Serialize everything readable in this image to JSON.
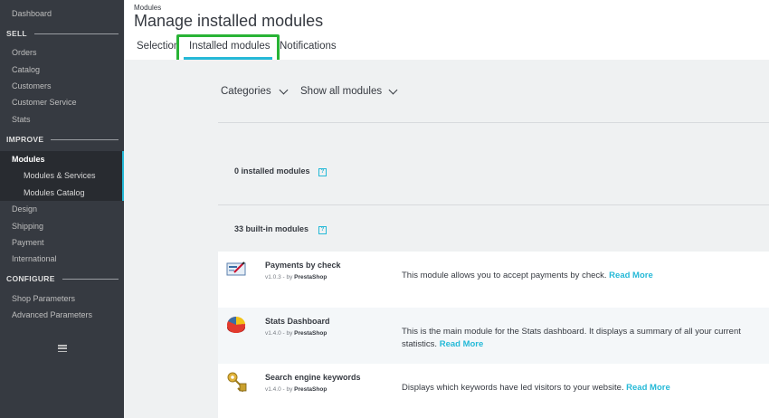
{
  "sidebar": {
    "dashboard": "Dashboard",
    "sections": {
      "sell": "SELL",
      "improve": "IMPROVE",
      "configure": "CONFIGURE"
    },
    "sell_items": [
      "Orders",
      "Catalog",
      "Customers",
      "Customer Service",
      "Stats"
    ],
    "improve_items": {
      "modules": "Modules",
      "modules_sub": [
        "Modules & Services",
        "Modules Catalog"
      ],
      "rest": [
        "Design",
        "Shipping",
        "Payment",
        "International"
      ]
    },
    "configure_items": [
      "Shop Parameters",
      "Advanced Parameters"
    ],
    "menu_icon": "hamburger-icon"
  },
  "header": {
    "breadcrumb": "Modules",
    "title": "Manage installed modules",
    "tabs": [
      "Selection",
      "Installed modules",
      "Notifications"
    ],
    "active_tab": "Installed modules"
  },
  "filters": {
    "categories": "Categories",
    "show": "Show all modules"
  },
  "counts": {
    "installed": "0 installed modules",
    "builtin": "33 built-in modules",
    "help": "?"
  },
  "modules": [
    {
      "name": "Payments by check",
      "version": "v1.0.3 - by",
      "author": "PrestaShop",
      "description": "This module allows you to accept payments by check.",
      "read_more": "Read More",
      "icon": "check-payment-icon"
    },
    {
      "name": "Stats Dashboard",
      "version": "v1.4.0 - by",
      "author": "PrestaShop",
      "description": "This is the main module for the Stats dashboard. It displays a summary of all your current statistics.",
      "read_more": "Read More",
      "icon": "pie-chart-icon"
    },
    {
      "name": "Search engine keywords",
      "version": "v1.4.0 - by",
      "author": "PrestaShop",
      "description": "Displays which keywords have led visitors to your website.",
      "read_more": "Read More",
      "icon": "keys-icon"
    }
  ],
  "colors": {
    "sidebar": "#363a41",
    "accent": "#25b9d7",
    "highlight": "#28b335"
  }
}
